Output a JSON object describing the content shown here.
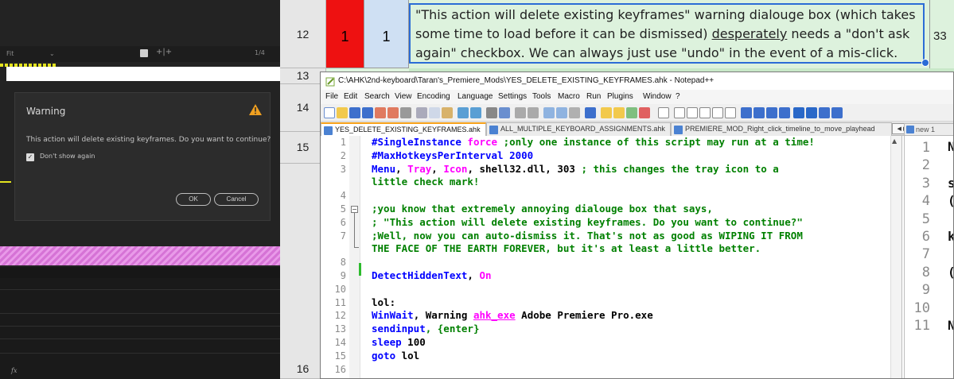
{
  "premiere": {
    "fit_label": "Fit",
    "fraction": "1/4",
    "fx_label": "fx",
    "dialog": {
      "title": "Warning",
      "message": "This action will delete existing keyframes. Do you want to continue?",
      "checkbox_label": "Don't show again",
      "checkbox_checked": true,
      "ok_label": "OK",
      "cancel_label": "Cancel"
    }
  },
  "sheet": {
    "rows": [
      "12",
      "13",
      "14",
      "15",
      "16"
    ],
    "cell_red": "1",
    "cell_blue": "1",
    "cell_text_lines": [
      "\"This action will delete existing keyframes\" warning dialouge box (which takes",
      "some time to load before it can be dismissed) ",
      "desperately",
      " needs a \"don't ask",
      "again\" checkbox. We can always just use \"undo\" in the event of a mis-click."
    ],
    "cell_right": "33",
    "colors": {
      "red": "#ee1111",
      "blue": "#cfe0f3",
      "green": "#ddf2dd",
      "selection": "#2b6cd6"
    }
  },
  "notepadpp": {
    "title": "C:\\AHK\\2nd-keyboard\\Taran's_Premiere_Mods\\YES_DELETE_EXISTING_KEYFRAMES.ahk - Notepad++",
    "menu": [
      "File",
      "Edit",
      "Search",
      "View",
      "Encoding",
      "Language",
      "Settings",
      "Tools",
      "Macro",
      "Run",
      "Plugins",
      "Window",
      "?"
    ],
    "tabs": [
      "YES_DELETE_EXISTING_KEYFRAMES.ahk",
      "ALL_MULTIPLE_KEYBOARD_ASSIGNMENTS.ahk",
      "PREMIERE_MOD_Right_click_timeline_to_move_playhead"
    ],
    "pane2_tab": "new 1",
    "line_numbers": [
      "1",
      "2",
      "3",
      "",
      "4",
      "5",
      "6",
      "7",
      "8",
      "9",
      "10",
      "11",
      "12",
      "13",
      "14",
      "15",
      "16"
    ],
    "code": {
      "l1a": "#SingleInstance",
      "l1b": " force",
      "l1c": " ;only one instance of this script may run at a time!",
      "l2": "#MaxHotkeysPerInterval 2000",
      "l3a": "Menu",
      "l3b": ", ",
      "l3c": "Tray",
      "l3d": ", ",
      "l3e": "Icon",
      "l3f": ", shell32.dll, 303 ",
      "l3g": "; this changes the tray icon to a",
      "l3h": "little check mark!",
      "l5": ";you know that extremely annoying dialouge box that says,",
      "l6": "; \"This action will delete existing keyframes. Do you want to continue?\"",
      "l7a": ";Well, now you can auto-dismiss it. That's not as good as WIPING IT FROM",
      "l7b": "THE FACE OF THE EARTH FOREVER, but it's at least a little better.",
      "l9a": "DetectHiddenText",
      "l9b": ", ",
      "l9c": "On",
      "l11": "lol:",
      "l12a": "WinWait",
      "l12b": ", Warning ",
      "l12c": "ahk_exe",
      "l12d": " Adobe Premiere Pro.exe",
      "l13a": "sendinput",
      "l13b": ", {enter}",
      "l14a": "sleep",
      "l14b": " 100",
      "l15a": "goto",
      "l15b": " lol"
    },
    "pane2_lines": [
      "1",
      "2",
      "3",
      "4",
      "5",
      "6",
      "7",
      "8",
      "9",
      "10",
      "11"
    ],
    "pane2_glyphs": [
      "N",
      "s",
      "(",
      "k",
      "(",
      "N"
    ]
  }
}
